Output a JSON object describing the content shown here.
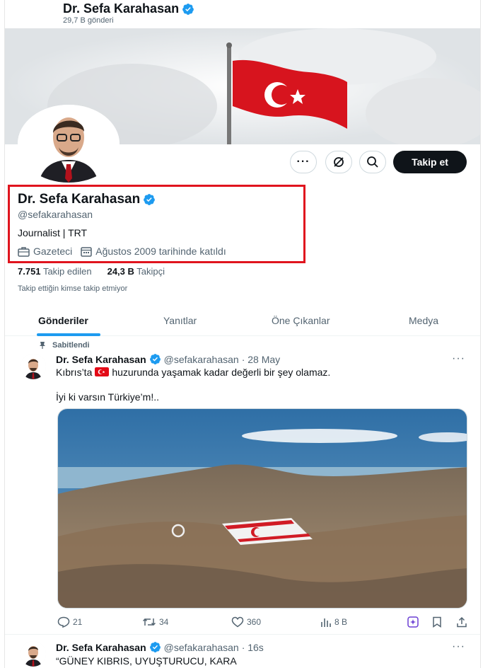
{
  "header": {
    "name": "Dr. Sefa Karahasan",
    "post_count": "29,7 B gönderi"
  },
  "profile": {
    "name": "Dr. Sefa Karahasan",
    "handle": "@sefakarahasan",
    "bio": "Journalist | TRT",
    "category": "Gazeteci",
    "joined": "Ağustos 2009 tarihinde katıldı",
    "following_count": "7.751",
    "following_label": "Takip edilen",
    "followers_count": "24,3 B",
    "followers_label": "Takipçi",
    "mutual_note": "Takip ettiğin kimse takip etmiyor",
    "follow_button": "Takip et"
  },
  "tabs": [
    "Gönderiler",
    "Yanıtlar",
    "Öne Çıkanlar",
    "Medya"
  ],
  "pinned_label": "Sabitlendi",
  "tweets": [
    {
      "name": "Dr. Sefa Karahasan",
      "handle": "@sefakarahasan",
      "time": "· 28 May",
      "text_before_flag": "Kıbrıs’ta",
      "text_after_flag": "huzurunda yaşamak kadar değerli bir şey olamaz.",
      "text_line2": "İyi ki varsın Türkiye’m!..",
      "replies": "21",
      "retweets": "34",
      "likes": "360",
      "views": "8 B"
    },
    {
      "name": "Dr. Sefa Karahasan",
      "handle": "@sefakarahasan",
      "time": "· 16s",
      "text": "“GÜNEY KIBRIS, UYUŞTURUCU, KARA"
    }
  ],
  "colors": {
    "accent": "#1d9bf0",
    "highlight_box": "#e0141e",
    "flag_red": "#e30a17"
  }
}
